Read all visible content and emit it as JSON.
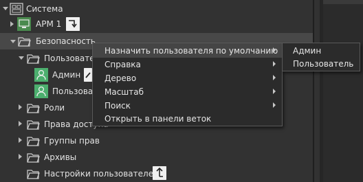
{
  "tree": {
    "items": [
      {
        "label": "Система"
      },
      {
        "label": "АРМ 1"
      },
      {
        "label": "Безопасность"
      },
      {
        "label": "Пользователи"
      },
      {
        "label": "Админ"
      },
      {
        "label": "Пользователь"
      },
      {
        "label": "Роли"
      },
      {
        "label": "Права доступа"
      },
      {
        "label": "Группы прав"
      },
      {
        "label": "Архивы"
      },
      {
        "label": "Настройки пользователей"
      }
    ]
  },
  "context_menu": {
    "items": [
      {
        "label": "Назначить пользователя по умолчанию",
        "has_submenu": true
      },
      {
        "label": "Справка",
        "has_submenu": true
      },
      {
        "label": "Дерево",
        "has_submenu": true
      },
      {
        "label": "Масштаб",
        "has_submenu": true
      },
      {
        "label": "Поиск",
        "has_submenu": true
      },
      {
        "label": "Открыть в панели веток",
        "has_submenu": false
      }
    ]
  },
  "submenu": {
    "items": [
      {
        "label": "Админ"
      },
      {
        "label": "Пользователь"
      }
    ]
  },
  "colors": {
    "background": "#323232",
    "selection": "#484848",
    "menu_background": "#2b2b2b",
    "user_icon": "#4caf6e",
    "text": "#e3e3e3"
  }
}
